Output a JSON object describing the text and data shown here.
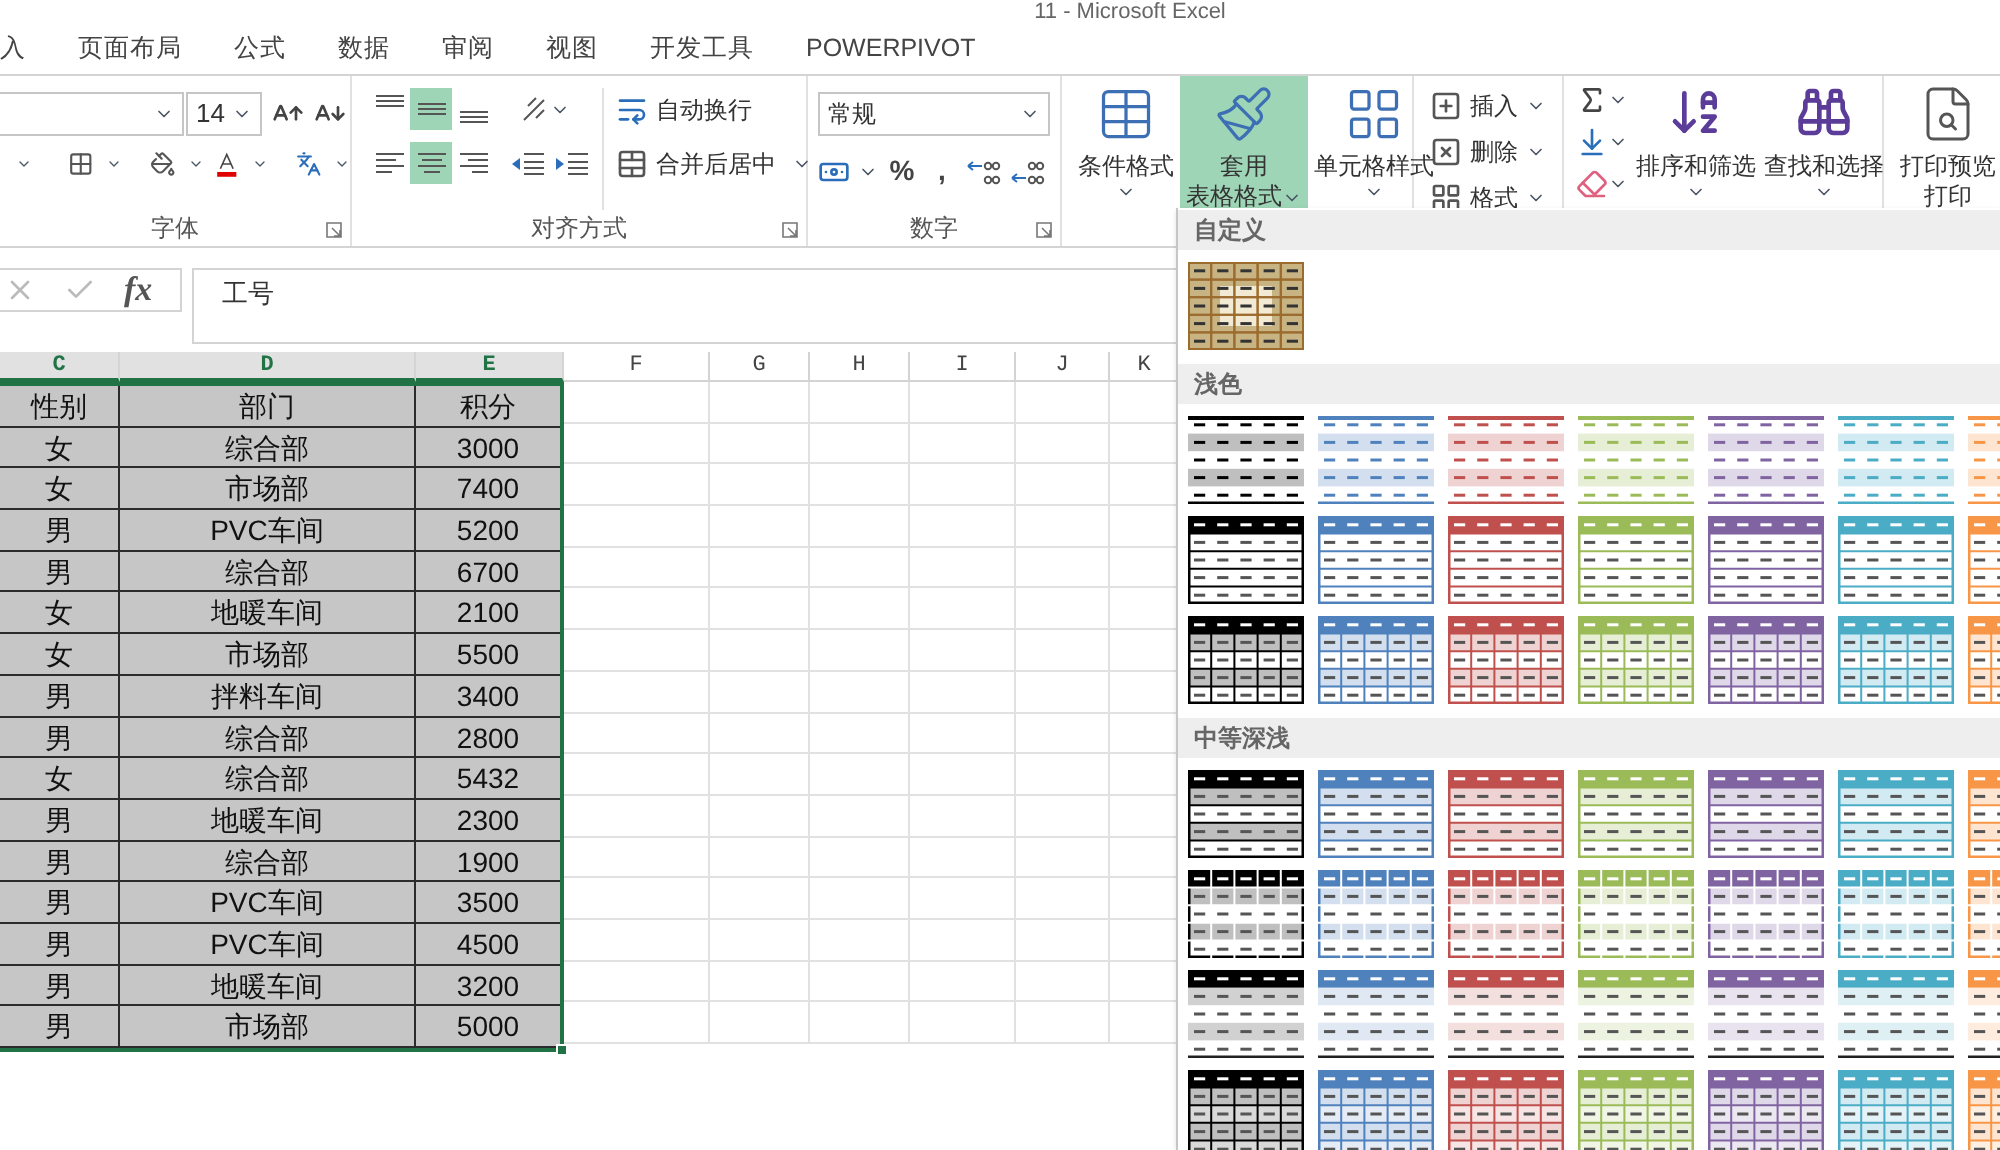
{
  "window": {
    "title": "11 - Microsoft Excel"
  },
  "tabs": [
    {
      "label": "入",
      "selected": false
    },
    {
      "label": "页面布局",
      "selected": false
    },
    {
      "label": "公式",
      "selected": false
    },
    {
      "label": "数据",
      "selected": false
    },
    {
      "label": "审阅",
      "selected": false
    },
    {
      "label": "视图",
      "selected": false
    },
    {
      "label": "开发工具",
      "selected": false
    },
    {
      "label": "POWERPIVOT",
      "selected": false
    }
  ],
  "ribbon": {
    "font_group": {
      "label": "字体",
      "size": "14"
    },
    "alignment_group": {
      "label": "对齐方式",
      "wrap": "自动换行",
      "merge": "合并后居中",
      "vertical": [
        {
          "selected": false
        },
        {
          "selected": true
        },
        {
          "selected": false
        }
      ],
      "horizontal": [
        {
          "selected": false
        },
        {
          "selected": true
        },
        {
          "selected": false
        }
      ]
    },
    "number_group": {
      "label": "数字",
      "format": "常规",
      "symbols": [
        "%",
        ","
      ]
    },
    "styles": [
      {
        "lines": [
          "条件格式"
        ],
        "selected": false
      },
      {
        "lines": [
          "套用",
          "表格格式"
        ],
        "selected": true
      },
      {
        "lines": [
          "单元格样式"
        ],
        "selected": false
      }
    ],
    "cells": [
      "插入",
      "删除",
      "格式"
    ],
    "editing": [
      "排序和筛选",
      "查找和选择"
    ],
    "print": {
      "lines": [
        "打印预览",
        "打印"
      ]
    }
  },
  "formula_bar": {
    "fx": "fx",
    "value": "工号"
  },
  "sheet": {
    "columns": [
      {
        "label": "C",
        "selected": true
      },
      {
        "label": "D",
        "selected": true
      },
      {
        "label": "E",
        "selected": true
      },
      {
        "label": "F",
        "selected": false
      },
      {
        "label": "G",
        "selected": false
      },
      {
        "label": "H",
        "selected": false
      },
      {
        "label": "I",
        "selected": false
      },
      {
        "label": "J",
        "selected": false
      },
      {
        "label": "K",
        "selected": false
      }
    ],
    "rows": [
      [
        "性别",
        "部门",
        "积分"
      ],
      [
        "女",
        "综合部",
        "3000"
      ],
      [
        "女",
        "市场部",
        "7400"
      ],
      [
        "男",
        "PVC车间",
        "5200"
      ],
      [
        "男",
        "综合部",
        "6700"
      ],
      [
        "女",
        "地暖车间",
        "2100"
      ],
      [
        "女",
        "市场部",
        "5500"
      ],
      [
        "男",
        "拌料车间",
        "3400"
      ],
      [
        "男",
        "综合部",
        "2800"
      ],
      [
        "女",
        "综合部",
        "5432"
      ],
      [
        "男",
        "地暖车间",
        "2300"
      ],
      [
        "男",
        "综合部",
        "1900"
      ],
      [
        "男",
        "PVC车间",
        "3500"
      ],
      [
        "男",
        "PVC车间",
        "4500"
      ],
      [
        "男",
        "地暖车间",
        "3200"
      ],
      [
        "男",
        "市场部",
        "5000"
      ]
    ]
  },
  "gallery": {
    "sections": [
      {
        "title": "自定义",
        "rows": [
          {
            "kind": "custom",
            "styles": [
              {
                "color": "#9c6b2e"
              }
            ]
          }
        ]
      },
      {
        "title": "浅色",
        "rows": [
          {
            "kind": "light-lines",
            "styles": [
              {
                "color": "#000000"
              },
              {
                "color": "#4f81bd"
              },
              {
                "color": "#c0504d"
              },
              {
                "color": "#9bbb59"
              },
              {
                "color": "#8064a2"
              },
              {
                "color": "#4bacc6"
              },
              {
                "color": "#f79646"
              }
            ]
          },
          {
            "kind": "light-header",
            "styles": [
              {
                "color": "#000000"
              },
              {
                "color": "#4f81bd"
              },
              {
                "color": "#c0504d"
              },
              {
                "color": "#9bbb59"
              },
              {
                "color": "#8064a2"
              },
              {
                "color": "#4bacc6"
              },
              {
                "color": "#f79646"
              }
            ]
          },
          {
            "kind": "light-grid",
            "styles": [
              {
                "color": "#000000"
              },
              {
                "color": "#4f81bd"
              },
              {
                "color": "#c0504d"
              },
              {
                "color": "#9bbb59"
              },
              {
                "color": "#8064a2"
              },
              {
                "color": "#4bacc6"
              },
              {
                "color": "#f79646"
              }
            ]
          }
        ]
      },
      {
        "title": "中等深浅",
        "rows": [
          {
            "kind": "medium-banded",
            "styles": [
              {
                "color": "#000000"
              },
              {
                "color": "#4f81bd"
              },
              {
                "color": "#c0504d"
              },
              {
                "color": "#9bbb59"
              },
              {
                "color": "#8064a2"
              },
              {
                "color": "#4bacc6"
              },
              {
                "color": "#f79646"
              }
            ]
          },
          {
            "kind": "medium-columns",
            "styles": [
              {
                "color": "#000000"
              },
              {
                "color": "#4f81bd"
              },
              {
                "color": "#c0504d"
              },
              {
                "color": "#9bbb59"
              },
              {
                "color": "#8064a2"
              },
              {
                "color": "#4bacc6"
              },
              {
                "color": "#f79646"
              }
            ]
          },
          {
            "kind": "medium-header",
            "styles": [
              {
                "color": "#000000"
              },
              {
                "color": "#4f81bd"
              },
              {
                "color": "#c0504d"
              },
              {
                "color": "#9bbb59"
              },
              {
                "color": "#8064a2"
              },
              {
                "color": "#4bacc6"
              },
              {
                "color": "#f79646"
              }
            ]
          },
          {
            "kind": "medium-grid",
            "styles": [
              {
                "color": "#000000"
              },
              {
                "color": "#4f81bd"
              },
              {
                "color": "#c0504d"
              },
              {
                "color": "#9bbb59"
              },
              {
                "color": "#8064a2"
              },
              {
                "color": "#4bacc6"
              },
              {
                "color": "#f79646"
              }
            ]
          }
        ]
      }
    ]
  }
}
